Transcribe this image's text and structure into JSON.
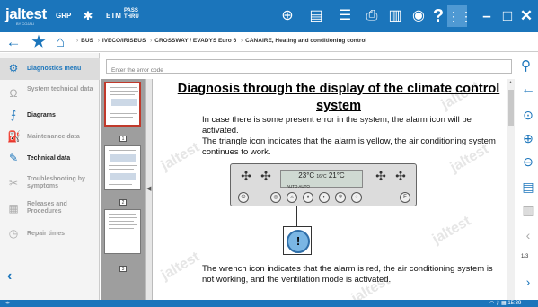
{
  "app": {
    "logo": "jaltest",
    "logo_sub": "BY COJALI",
    "mode_grp": "GRP",
    "mode_etm": "ETM",
    "mode_pass": "PASS",
    "mode_thru": "THRU"
  },
  "breadcrumb": [
    "BUS",
    "IVECO/IRISBUS",
    "CROSSWAY / EVADYS Euro 6",
    "CANAIRE, Heating and conditioning control"
  ],
  "sidebar": {
    "items": [
      {
        "label": "Diagnostics menu",
        "icon": "diagnostics-icon",
        "state": "active"
      },
      {
        "label": "System technical data",
        "icon": "omega-icon",
        "state": "disabled"
      },
      {
        "label": "Diagrams",
        "icon": "diagram-icon",
        "state": "enabled"
      },
      {
        "label": "Maintenance data",
        "icon": "oil-can-icon",
        "state": "disabled"
      },
      {
        "label": "Technical data",
        "icon": "wrench-icon",
        "state": "enabled"
      },
      {
        "label": "Troubleshooting by symptoms",
        "icon": "tools-icon",
        "state": "disabled"
      },
      {
        "label": "Releases and Procedures",
        "icon": "document-icon",
        "state": "disabled"
      },
      {
        "label": "Repair times",
        "icon": "clock-icon",
        "state": "disabled"
      }
    ]
  },
  "search": {
    "placeholder": "Enter the error code"
  },
  "thumbnails": {
    "pages": [
      "1",
      "2",
      "3"
    ],
    "selected": "1"
  },
  "document": {
    "title": "Diagnosis through the display of the climate control system",
    "p1": "In case there is some present error in the system, the alarm icon will be activated.",
    "p2": "The triangle icon indicates that the alarm is yellow, the air conditioning system continues to work.",
    "p3": "The wrench icon indicates that the alarm is red, the air conditioning system is not working, and the ventilation mode is activated.",
    "watermark": "jaltest",
    "panel": {
      "temp_left": "23°C",
      "temp_mid": "16°C",
      "temp_right": "21°C",
      "lcd_small": "AUTO  AUTO",
      "btn_f": "F"
    },
    "alarm_glyph": "!"
  },
  "pager": {
    "current": "1/3"
  },
  "status": {
    "time": "15:39"
  }
}
